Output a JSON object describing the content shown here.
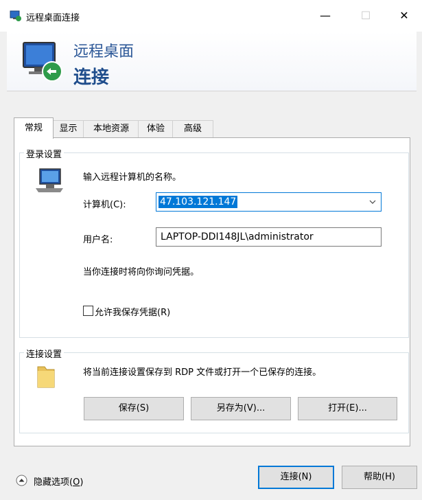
{
  "window": {
    "title": "远程桌面连接",
    "controls": {
      "minimize": "—",
      "maximize": "☐",
      "close": "✕"
    }
  },
  "banner": {
    "line1": "远程桌面",
    "line2": "连接"
  },
  "tabs": [
    {
      "label": "常规",
      "active": true
    },
    {
      "label": "显示",
      "active": false
    },
    {
      "label": "本地资源",
      "active": false
    },
    {
      "label": "体验",
      "active": false
    },
    {
      "label": "高级",
      "active": false
    }
  ],
  "login": {
    "legend": "登录设置",
    "prompt": "输入远程计算机的名称。",
    "computer_label": "计算机(C):",
    "computer_value": "47.103.121.147",
    "username_label": "用户名:",
    "username_value": "LAPTOP-DDI148JL\\administrator",
    "credentials_note": "当你连接时将向你询问凭据。",
    "save_credentials_label": "允许我保存凭据(R)",
    "save_credentials_checked": false
  },
  "connection": {
    "legend": "连接设置",
    "description": "将当前连接设置保存到 RDP 文件或打开一个已保存的连接。",
    "save_button": "保存(S)",
    "save_as_button": "另存为(V)...",
    "open_button": "打开(E)..."
  },
  "footer": {
    "hide_options_label": "隐藏选项(",
    "hide_options_key": "O",
    "hide_options_close": ")",
    "connect_button": "连接(N)",
    "help_button": "帮助(H)"
  }
}
